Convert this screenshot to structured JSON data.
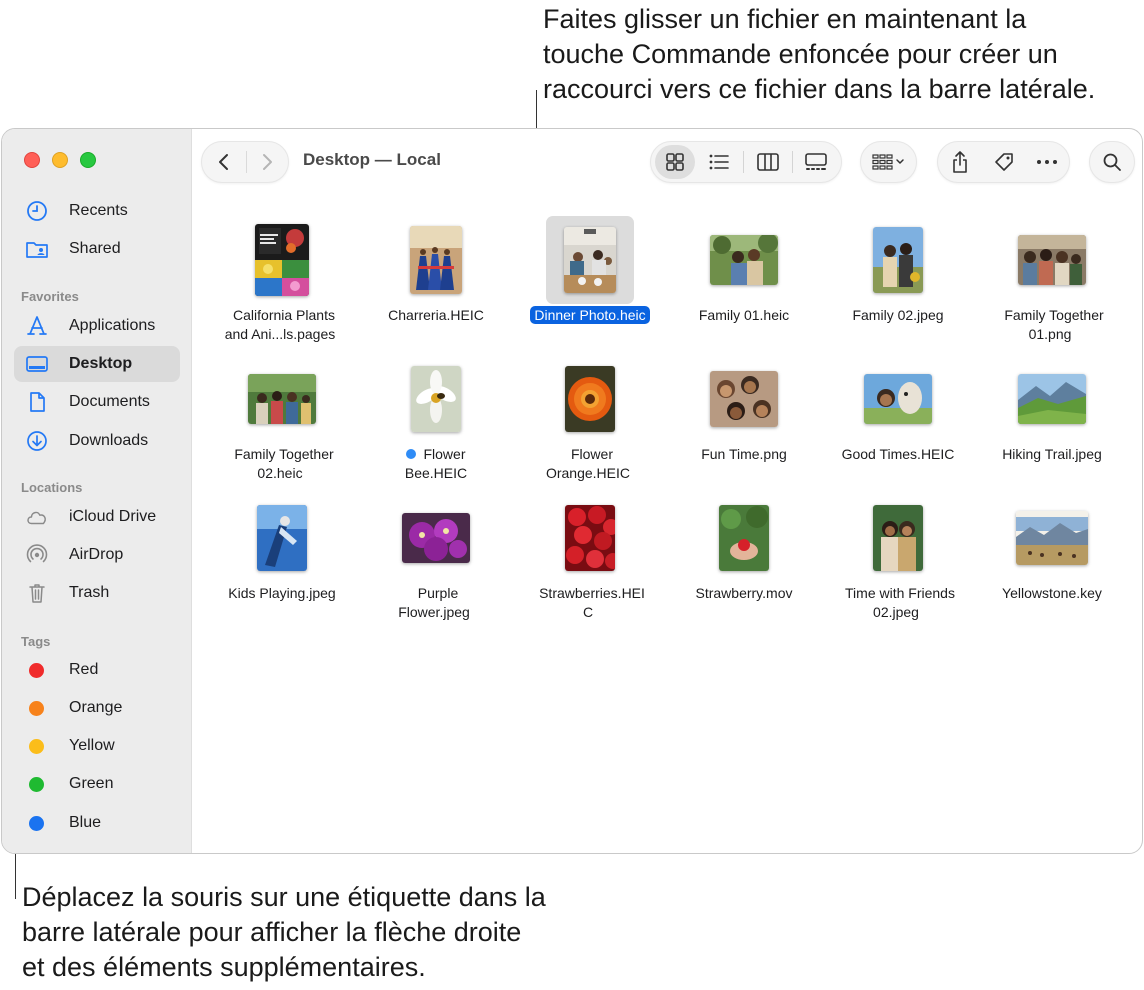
{
  "callouts": {
    "top": "Faites glisser un fichier en maintenant la\ntouche Commande enfoncée pour créer un\nraccourci vers ce fichier dans la barre latérale.",
    "bottom": "Déplacez la souris sur une étiquette dans la\nbarre latérale pour afficher la flèche droite\net des éléments supplémentaires."
  },
  "window": {
    "title": "Desktop — Local"
  },
  "sidebar": {
    "items_top": [
      {
        "label": "Recents",
        "icon": "clock-icon"
      },
      {
        "label": "Shared",
        "icon": "shared-folder-icon"
      }
    ],
    "favorites_header": "Favorites",
    "favorites": [
      {
        "label": "Applications",
        "icon": "applications-icon"
      },
      {
        "label": "Desktop",
        "icon": "desktop-icon",
        "selected": true
      },
      {
        "label": "Documents",
        "icon": "document-icon"
      },
      {
        "label": "Downloads",
        "icon": "download-icon"
      }
    ],
    "locations_header": "Locations",
    "locations": [
      {
        "label": "iCloud Drive",
        "icon": "cloud-icon"
      },
      {
        "label": "AirDrop",
        "icon": "airdrop-icon"
      },
      {
        "label": "Trash",
        "icon": "trash-icon"
      }
    ],
    "tags_header": "Tags",
    "tags": [
      {
        "label": "Red",
        "color": "#f02b2b"
      },
      {
        "label": "Orange",
        "color": "#f7821b"
      },
      {
        "label": "Yellow",
        "color": "#fbbd1a"
      },
      {
        "label": "Green",
        "color": "#1fba31"
      },
      {
        "label": "Blue",
        "color": "#1a73f0"
      }
    ]
  },
  "files": [
    {
      "name": "California Plants\nand Ani...ls.pages"
    },
    {
      "name": "Charreria.HEIC"
    },
    {
      "name": "Dinner Photo.heic",
      "selected": true
    },
    {
      "name": "Family 01.heic"
    },
    {
      "name": "Family 02.jpeg"
    },
    {
      "name": "Family Together\n01.png"
    },
    {
      "name": "Family Together\n02.heic"
    },
    {
      "name": "Flower\nBee.HEIC",
      "tag_color": "#2f8cf6"
    },
    {
      "name": "Flower\nOrange.HEIC"
    },
    {
      "name": "Fun Time.png"
    },
    {
      "name": "Good Times.HEIC"
    },
    {
      "name": "Hiking Trail.jpeg"
    },
    {
      "name": "Kids Playing.jpeg"
    },
    {
      "name": "Purple\nFlower.jpeg"
    },
    {
      "name": "Strawberries.HEI\nC"
    },
    {
      "name": "Strawberry.mov"
    },
    {
      "name": "Time with Friends\n02.jpeg"
    },
    {
      "name": "Yellowstone.key"
    }
  ]
}
